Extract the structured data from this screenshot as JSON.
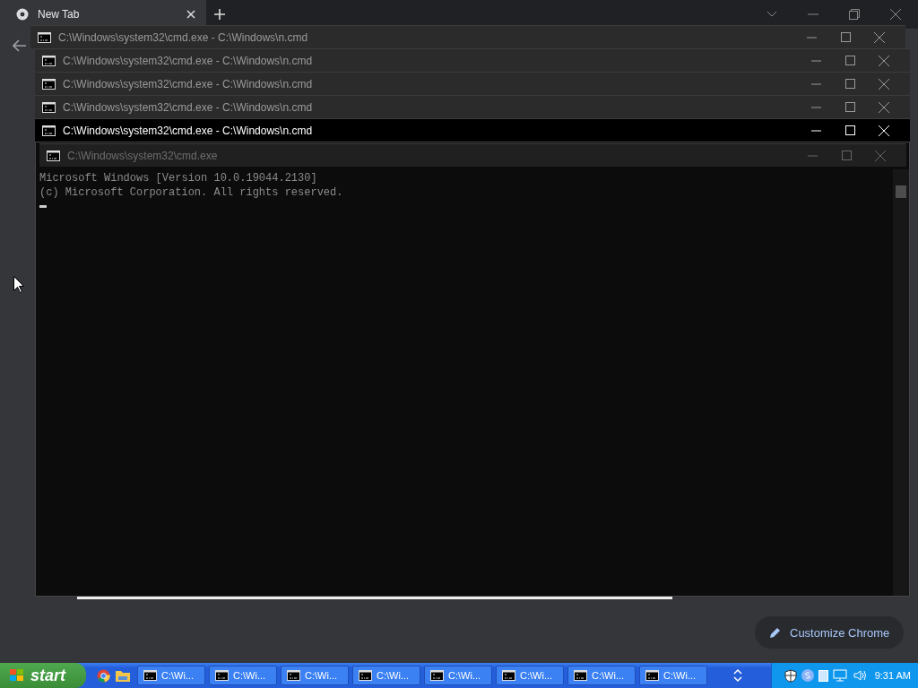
{
  "browser": {
    "tab": {
      "title": "New Tab",
      "selected": true
    },
    "customize_button": "Customize Chrome"
  },
  "windows": [
    {
      "title": "C:\\Windows\\system32\\cmd.exe - C:\\Windows\\n.cmd",
      "kind": "normal",
      "selected": false
    },
    {
      "title": "C:\\Windows\\system32\\cmd.exe - C:\\Windows\\n.cmd",
      "kind": "normal",
      "selected": false
    },
    {
      "title": "C:\\Windows\\system32\\cmd.exe - C:\\Windows\\n.cmd",
      "kind": "normal",
      "selected": false
    },
    {
      "title": "C:\\Windows\\system32\\cmd.exe - C:\\Windows\\n.cmd",
      "kind": "normal",
      "selected": false
    },
    {
      "title": "C:\\Windows\\system32\\cmd.exe - C:\\Windows\\n.cmd",
      "kind": "normal",
      "selected": true
    },
    {
      "title": "C:\\Windows\\system32\\cmd.exe",
      "kind": "ghost",
      "selected": false
    }
  ],
  "console": {
    "lines": [
      "Microsoft Windows [Version 10.0.19044.2130]",
      "(c) Microsoft Corporation. All rights reserved."
    ]
  },
  "taskbar": {
    "start": "start",
    "buttons": [
      "C:\\Wi...",
      "C:\\Wi...",
      "C:\\Wi...",
      "C:\\Wi...",
      "C:\\Wi...",
      "C:\\Wi...",
      "C:\\Wi...",
      "C:\\Wi..."
    ],
    "clock": "9:31 AM"
  }
}
